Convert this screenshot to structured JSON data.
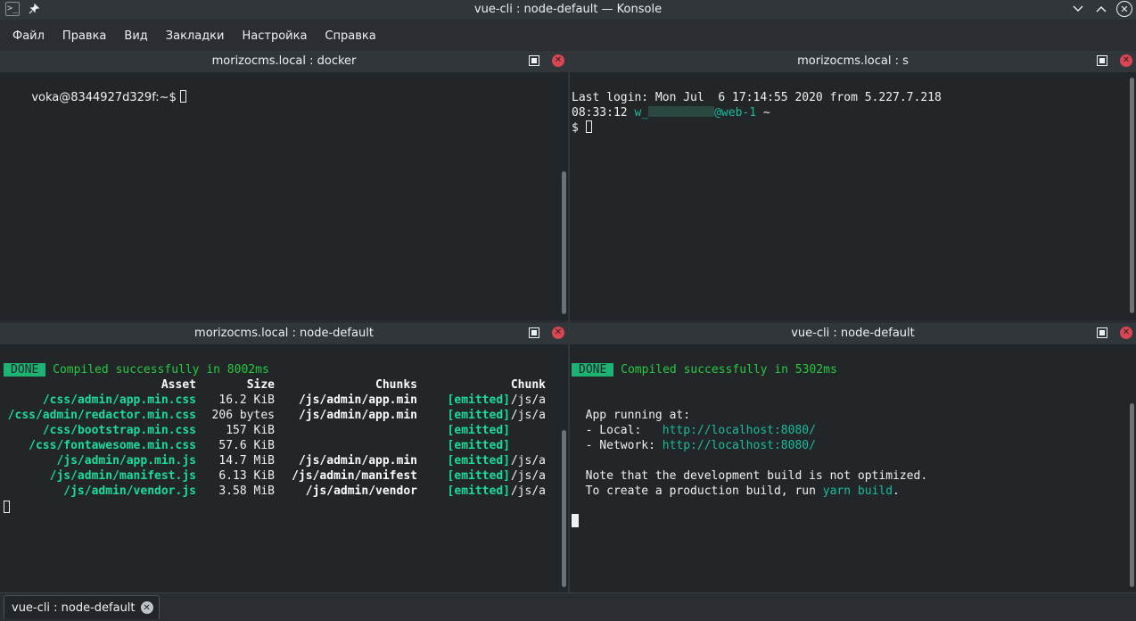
{
  "window": {
    "title": "vue-cli : node-default — Konsole",
    "app_icon": "terminal-icon",
    "pin_icon": "pin-icon",
    "controls": [
      "chevron-down-icon",
      "chevron-up-icon",
      "close-icon"
    ]
  },
  "menu": [
    "Файл",
    "Правка",
    "Вид",
    "Закладки",
    "Настройка",
    "Справка"
  ],
  "panes": {
    "top_left": {
      "title": "morizocms.local : docker",
      "prompt": "voka@8344927d329f:~$ "
    },
    "top_right": {
      "title": "morizocms.local : s",
      "line1": "Last login: Mon Jul  6 17:14:55 2020 from 5.227.7.218",
      "line2_time": "08:33:12 ",
      "line2_user": "w_",
      "line2_host": "@web-1",
      "line2_tail": " ~",
      "prompt": "$ "
    },
    "bottom_left": {
      "title": "morizocms.local : node-default",
      "done": "DONE",
      "compiled": "Compiled successfully in 8002ms",
      "headers": [
        "Asset",
        "Size",
        "Chunks",
        "",
        "Chunk"
      ],
      "rows": [
        [
          "/css/admin/app.min.css",
          "16.2 KiB",
          "/js/admin/app.min",
          "[emitted]",
          "/js/a"
        ],
        [
          "/css/admin/redactor.min.css",
          "206 bytes",
          "/js/admin/app.min",
          "[emitted]",
          "/js/a"
        ],
        [
          "/css/bootstrap.min.css",
          "157 KiB",
          "",
          "[emitted]",
          ""
        ],
        [
          "/css/fontawesome.min.css",
          "57.6 KiB",
          "",
          "[emitted]",
          ""
        ],
        [
          "/js/admin/app.min.js",
          "14.7 MiB",
          "/js/admin/app.min",
          "[emitted]",
          "/js/a"
        ],
        [
          "/js/admin/manifest.js",
          "6.13 KiB",
          "/js/admin/manifest",
          "[emitted]",
          "/js/a"
        ],
        [
          "/js/admin/vendor.js",
          "3.58 MiB",
          "/js/admin/vendor",
          "[emitted]",
          "/js/a"
        ]
      ]
    },
    "bottom_right": {
      "title": "vue-cli : node-default",
      "done": "DONE",
      "compiled": "Compiled successfully in 5302ms",
      "running": "App running at:",
      "local_label": "- Local:   ",
      "local_url": "http://localhost:8080/",
      "network_label": "- Network: ",
      "network_url": "http://localhost:8080/",
      "note1": "Note that the development build is not optimized.",
      "note2_pre": "To create a production build, run ",
      "note2_cmd": "yarn build",
      "note2_post": "."
    }
  },
  "tabs": [
    {
      "label": "vue-cli : node-default"
    }
  ],
  "colors": {
    "accent_green": "#1cdc9a",
    "close_red": "#da4453",
    "background": "#232629"
  }
}
